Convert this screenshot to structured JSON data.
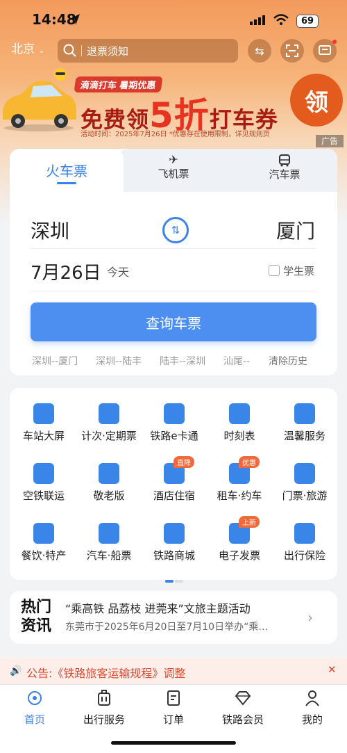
{
  "status_bar": {
    "time": "14:48",
    "battery": "69"
  },
  "header": {
    "city": "北京",
    "search_placeholder": "退票须知"
  },
  "banner": {
    "tag": "滴滴打车 暑期优惠",
    "headline_pre": "免费领",
    "headline_num": "5折",
    "headline_post": "打车券",
    "sub": "活动时间：2025年7月26日  *优惠存在使用限制，详见规则页",
    "action": "领",
    "ad_label": "广告"
  },
  "ticket": {
    "tabs": [
      {
        "label": "火车票"
      },
      {
        "label": "飞机票"
      },
      {
        "label": "汽车票"
      }
    ],
    "from": "深圳",
    "to": "厦门",
    "date": "7月26日",
    "date_note": "今天",
    "student_label": "学生票",
    "search_button": "查询车票",
    "history": [
      "深圳--厦门",
      "深圳--陆丰",
      "陆丰--深圳",
      "汕尾--"
    ],
    "clear_history": "清除历史"
  },
  "services": [
    {
      "label": "车站大屏",
      "icon": "screen-icon",
      "color": "#3a86e8"
    },
    {
      "label": "计次·定期票",
      "icon": "ticket-clock-icon",
      "color": "#3a86e8"
    },
    {
      "label": "铁路e卡通",
      "icon": "ecard-icon",
      "color": "#3a86e8"
    },
    {
      "label": "时刻表",
      "icon": "train-icon",
      "color": "#3a86e8"
    },
    {
      "label": "温馨服务",
      "icon": "heart-service-icon",
      "color": "#3a86e8"
    },
    {
      "label": "空铁联运",
      "icon": "plane-train-icon",
      "color": "#3a86e8"
    },
    {
      "label": "敬老版",
      "icon": "heart-icon",
      "color": "#3a86e8"
    },
    {
      "label": "酒店住宿",
      "icon": "hotel-icon",
      "color": "#3a86e8",
      "tag": "直降"
    },
    {
      "label": "租车·约车",
      "icon": "car-icon",
      "color": "#3a86e8",
      "tag": "优惠"
    },
    {
      "label": "门票·旅游",
      "icon": "mountain-icon",
      "color": "#3a86e8"
    },
    {
      "label": "餐饮·特产",
      "icon": "dining-icon",
      "color": "#3a86e8"
    },
    {
      "label": "汽车·船票",
      "icon": "bus-icon",
      "color": "#3a86e8"
    },
    {
      "label": "铁路商城",
      "icon": "shop-icon",
      "color": "#3a86e8"
    },
    {
      "label": "电子发票",
      "icon": "invoice-icon",
      "color": "#3a86e8",
      "tag": "上新"
    },
    {
      "label": "出行保险",
      "icon": "insurance-icon",
      "color": "#3a86e8"
    }
  ],
  "news": {
    "logo_line1": "热门",
    "logo_line2": "资讯",
    "title": "“乘高铁 品荔枝 进莞来”文旅主题活动",
    "summary": "东莞市于2025年6月20日至7月10日举办“乘…"
  },
  "notice": {
    "text": "公告:《铁路旅客运输规程》调整"
  },
  "bottom_nav": [
    {
      "label": "首页",
      "icon": "home-icon",
      "active": true
    },
    {
      "label": "出行服务",
      "icon": "luggage-icon"
    },
    {
      "label": "订单",
      "icon": "order-icon"
    },
    {
      "label": "铁路会员",
      "icon": "diamond-icon"
    },
    {
      "label": "我的",
      "icon": "user-icon"
    }
  ],
  "colors": {
    "accent": "#4d8ff0",
    "notice": "#e24a2e"
  }
}
